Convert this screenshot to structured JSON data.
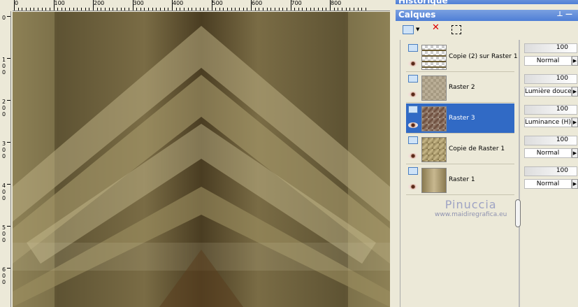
{
  "ruler": {
    "h_labels": [
      "0",
      "100",
      "200",
      "300",
      "400",
      "500",
      "600",
      "700",
      "800"
    ],
    "v_labels": [
      "0",
      "100",
      "200",
      "300",
      "400",
      "500",
      "600"
    ]
  },
  "panels": {
    "history_title": "Historique",
    "layers_title": "Calques"
  },
  "toolbar": {
    "icons": [
      "new-layer-icon",
      "delete-layer-icon",
      "edit-selection-icon"
    ]
  },
  "layers": [
    {
      "name": "Copie (2) sur Raster 1",
      "opacity": "100",
      "blend": "Normal",
      "selected": false
    },
    {
      "name": "Raster 2",
      "opacity": "100",
      "blend": "Lumière douce",
      "selected": false
    },
    {
      "name": "Raster 3",
      "opacity": "100",
      "blend": "Luminance (H)",
      "selected": true
    },
    {
      "name": "Copie de Raster 1",
      "opacity": "100",
      "blend": "Normal",
      "selected": false
    },
    {
      "name": "Raster 1",
      "opacity": "100",
      "blend": "Normal",
      "selected": false
    }
  ],
  "watermark": {
    "name": "Pinuccia",
    "url": "www.maidiregrafica.eu"
  }
}
